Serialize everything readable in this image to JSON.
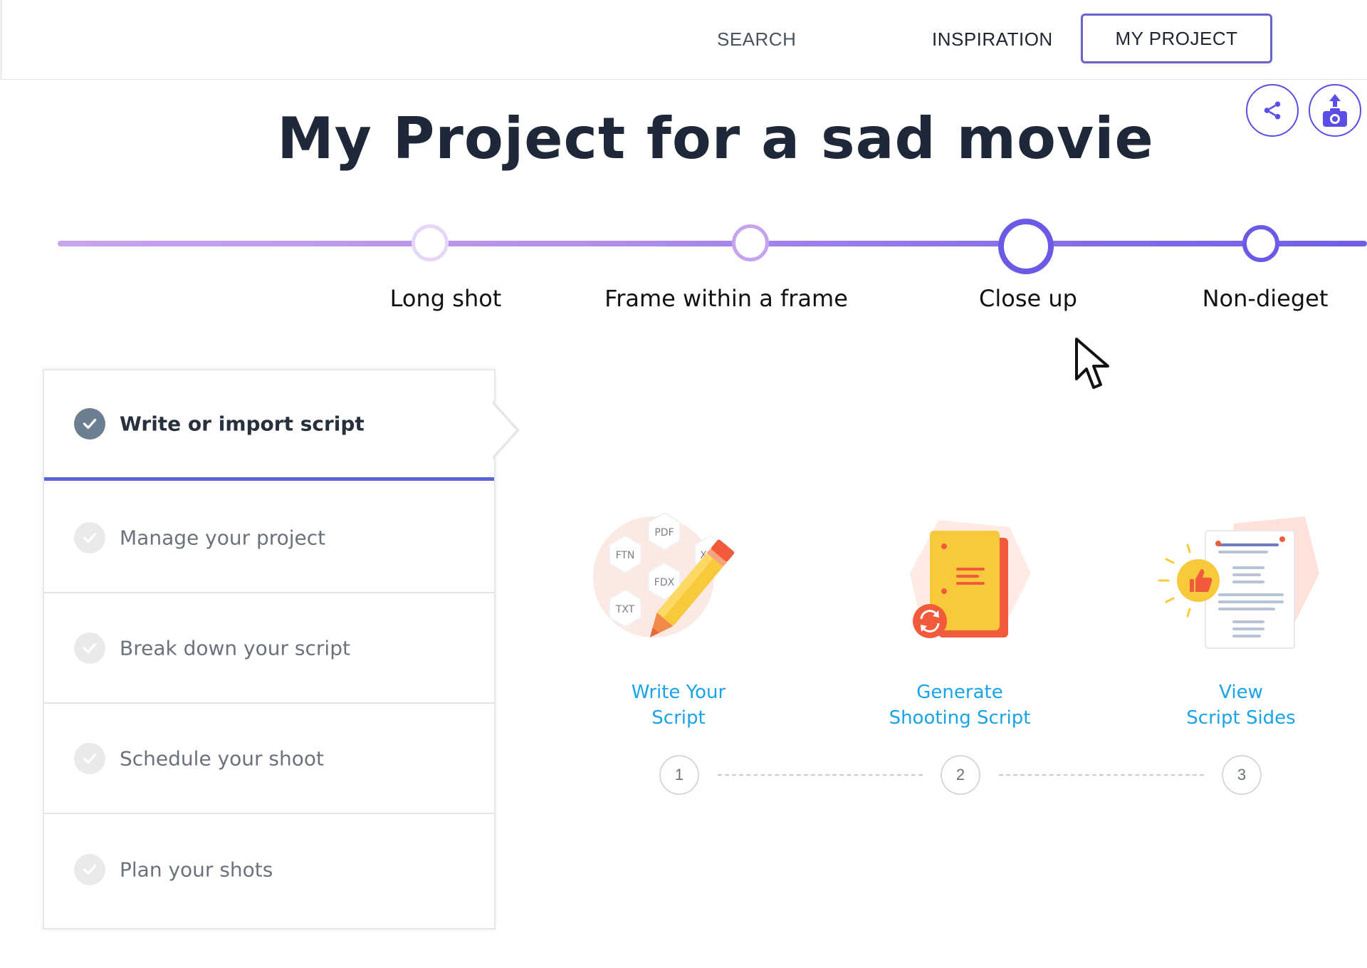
{
  "nav": {
    "search": "SEARCH",
    "inspiration": "INSPIRATION",
    "my_project": "MY PROJECT"
  },
  "actions": {
    "share_icon": "share-icon",
    "upload_icon": "camera-upload-icon"
  },
  "project": {
    "title": "My Project for a sad movie"
  },
  "timeline": {
    "nodes": [
      {
        "label": "Long shot"
      },
      {
        "label": "Frame within a frame"
      },
      {
        "label": "Close up",
        "active": true
      },
      {
        "label": "Non-dieget"
      }
    ]
  },
  "steps": [
    {
      "label": "Write or import script",
      "done": true,
      "active": true
    },
    {
      "label": "Manage your project",
      "done": false
    },
    {
      "label": "Break down your script",
      "done": false
    },
    {
      "label": "Schedule your shoot",
      "done": false
    },
    {
      "label": "Plan your shots",
      "done": false
    }
  ],
  "features": [
    {
      "line1": "Write Your",
      "line2": "Script",
      "number": "1",
      "formats": [
        "PDF",
        "FTN",
        "XML",
        "FDX",
        "TXT"
      ]
    },
    {
      "line1": "Generate",
      "line2": "Shooting Script",
      "number": "2"
    },
    {
      "line1": "View",
      "line2": "Script Sides",
      "number": "3"
    }
  ],
  "colors": {
    "accent": "#5b4ee6",
    "link": "#1aa3e8",
    "active_step_underline": "#5a63d8"
  }
}
